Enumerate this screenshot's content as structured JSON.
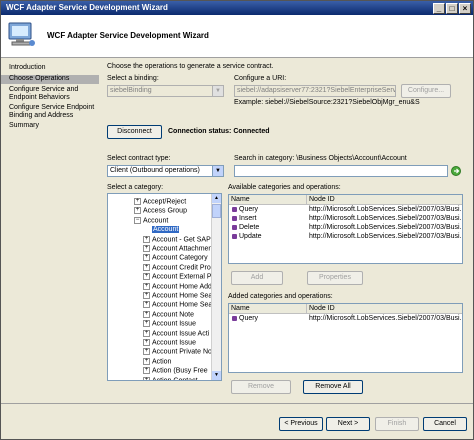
{
  "window": {
    "title": "WCF Adapter Service Development Wizard"
  },
  "header": {
    "title": "WCF Adapter Service Development Wizard"
  },
  "nav": {
    "items": [
      "Introduction",
      "Choose Operations",
      "Configure Service and Endpoint Behaviors",
      "Configure Service Endpoint Binding and Address",
      "Summary"
    ]
  },
  "main": {
    "intro": "Choose the operations to generate a service contract.",
    "binding_label": "Select a binding:",
    "binding_value": "siebelBinding",
    "uri_label": "Configure a URI:",
    "uri_value": "siebel://adapsiserver77:2321?SiebelEnterpriseServer=ent",
    "configure_label": "Configure...",
    "example": "Example: siebel://SiebelSource:2321?SiebelObjMgr_enu&S",
    "disconnect_label": "Disconnect",
    "status": "Connection status: Connected",
    "contract_label": "Select contract type:",
    "contract_value": "Client (Outbound operations)",
    "search_label": "Search in category: \\Business Objects\\Account\\Account",
    "search_value": "",
    "category_label": "Select a category:",
    "available_label": "Available categories and operations:",
    "added_label": "Added categories and operations:",
    "add_label": "Add",
    "properties_label": "Properties",
    "remove_label": "Remove",
    "remove_all_label": "Remove All"
  },
  "tree": {
    "items": [
      {
        "label": "Accept/Reject",
        "exp": "+"
      },
      {
        "label": "Access Group",
        "exp": "+"
      },
      {
        "label": "Account",
        "exp": "−"
      },
      {
        "label": "Account",
        "exp": ""
      },
      {
        "label": "Account - Get SAP",
        "exp": "+"
      },
      {
        "label": "Account Attachmen",
        "exp": "+"
      },
      {
        "label": "Account Category",
        "exp": "+"
      },
      {
        "label": "Account Credit Pro",
        "exp": "+"
      },
      {
        "label": "Account External P",
        "exp": "+"
      },
      {
        "label": "Account Home Add",
        "exp": "+"
      },
      {
        "label": "Account Home Sea",
        "exp": "+"
      },
      {
        "label": "Account Home Sea",
        "exp": "+"
      },
      {
        "label": "Account Note",
        "exp": "+"
      },
      {
        "label": "Account Issue",
        "exp": "+"
      },
      {
        "label": "Account Issue Acti",
        "exp": "+"
      },
      {
        "label": "Account Issue",
        "exp": "+"
      },
      {
        "label": "Account Private No",
        "exp": "+"
      },
      {
        "label": "Action",
        "exp": "+"
      },
      {
        "label": "Action (Busy Free",
        "exp": "+"
      },
      {
        "label": "Action Contact",
        "exp": "+"
      },
      {
        "label": "Action Employee",
        "exp": "+"
      }
    ]
  },
  "grid_columns": [
    "Name",
    "Node ID"
  ],
  "available_rows": [
    {
      "name": "Query",
      "node": "http://Microsoft.LobServices.Siebel/2007/03/Busi..."
    },
    {
      "name": "Insert",
      "node": "http://Microsoft.LobServices.Siebel/2007/03/Busi..."
    },
    {
      "name": "Delete",
      "node": "http://Microsoft.LobServices.Siebel/2007/03/Busi..."
    },
    {
      "name": "Update",
      "node": "http://Microsoft.LobServices.Siebel/2007/03/Busi..."
    }
  ],
  "added_rows": [
    {
      "name": "Query",
      "node": "http://Microsoft.LobServices.Siebel/2007/03/Busi..."
    }
  ],
  "footer": {
    "previous": "< Previous",
    "next": "Next >",
    "finish": "Finish",
    "cancel": "Cancel"
  },
  "colors": {
    "title_bar": "#0b2a6e",
    "selection": "#316ac5",
    "nav_selected": "#b0b0b0"
  }
}
